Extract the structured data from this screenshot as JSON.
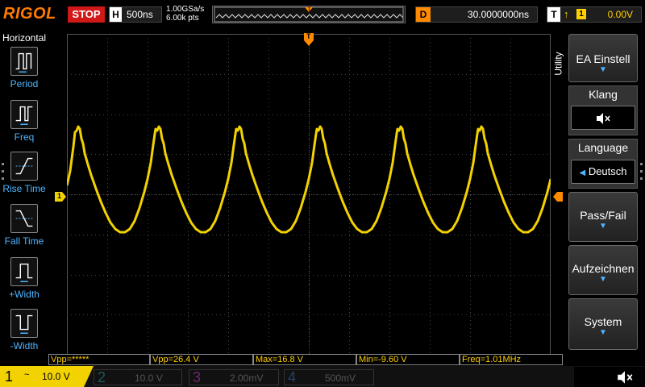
{
  "header": {
    "brand": "RIGOL",
    "run_state": "STOP",
    "timebase_letter": "H",
    "timebase": "500ns",
    "sample_rate": "1.00GSa/s",
    "mem_depth": "6.00k pts",
    "memory_marker": "T",
    "delay_letter": "D",
    "delay": "30.0000000ns",
    "trigger_letter": "T",
    "trigger_source": "1",
    "trigger_level": "0.00V"
  },
  "left_panel": {
    "title": "Horizontal",
    "items": [
      {
        "label": "Period",
        "icon": "period-icon"
      },
      {
        "label": "Freq",
        "icon": "freq-icon"
      },
      {
        "label": "Rise Time",
        "icon": "rise-time-icon"
      },
      {
        "label": "Fall Time",
        "icon": "fall-time-icon"
      },
      {
        "label": "+Width",
        "icon": "positive-width-icon"
      },
      {
        "label": "-Width",
        "icon": "negative-width-icon"
      }
    ]
  },
  "right_panel": {
    "side_label": "Utility",
    "ea_einstell": "EA Einstell",
    "klang_head": "Klang",
    "klang_icon": "speaker-muted-icon",
    "language_head": "Language",
    "language_value": "Deutsch",
    "pass_fail": "Pass/Fail",
    "aufzeichnen": "Aufzeichnen",
    "system": "System"
  },
  "markers": {
    "trigger_pos": "T",
    "ch1_level": "1"
  },
  "measurements": {
    "vpp_stars": "Vpp=*****",
    "vpp": "Vpp=26.4 V",
    "max": "Max=16.8 V",
    "min": "Min=-9.60 V",
    "freq": "Freq=1.01MHz"
  },
  "channels": [
    {
      "num": "1",
      "coupling": "~",
      "scale": "10.0 V",
      "color": "#f2d200"
    },
    {
      "num": "2",
      "scale": "10.0 V",
      "color": "#00c1c1"
    },
    {
      "num": "3",
      "scale": "2.00mV",
      "color": "#e040e0"
    },
    {
      "num": "4",
      "scale": "500mV",
      "color": "#3a6cff"
    }
  ],
  "bottom_icon": "speaker-muted-icon",
  "waveform": {
    "color": "#f2d200",
    "frequency_label": "Freq=1.01MHz",
    "visible_cycles": 6
  }
}
